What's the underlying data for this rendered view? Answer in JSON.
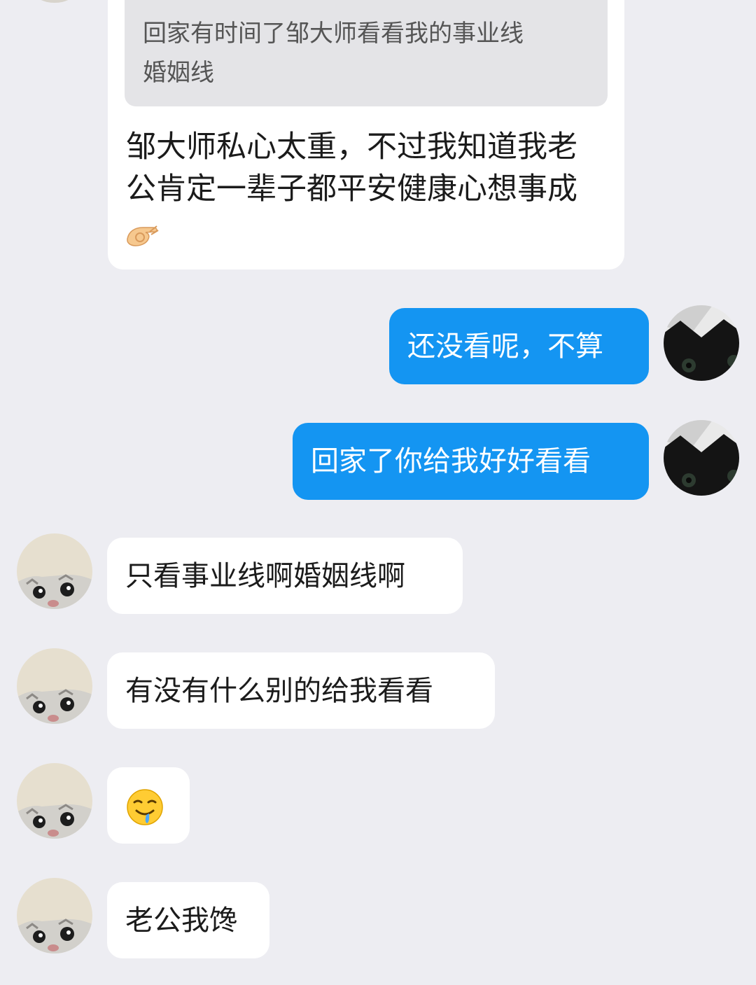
{
  "chat": {
    "quoted_message": {
      "line1": "回家有时间了邹大师看看我的事业线",
      "line2": "婚姻线"
    },
    "messages": [
      {
        "sender": "other",
        "line1": "邹大师私心太重，不过我知道我老",
        "line2": "公肯定一辈子都平安健康心想事成",
        "emoji": "ok-hand-emoji"
      },
      {
        "sender": "self",
        "text": "还没看呢，不算"
      },
      {
        "sender": "self",
        "text": "回家了你给我好好看看"
      },
      {
        "sender": "other",
        "text": "只看事业线啊婚姻线啊"
      },
      {
        "sender": "other",
        "text": "有没有什么别的给我看看"
      },
      {
        "sender": "other",
        "emoji": "drooling-face-emoji"
      },
      {
        "sender": "other",
        "text": "老公我馋"
      }
    ]
  },
  "colors": {
    "background": "#ededf2",
    "incoming_bubble": "#ffffff",
    "outgoing_bubble": "#1495f2",
    "quote_box": "#e4e4e7"
  },
  "avatars": {
    "self": "black-cat-avatar",
    "other": "grey-kitten-avatar"
  }
}
